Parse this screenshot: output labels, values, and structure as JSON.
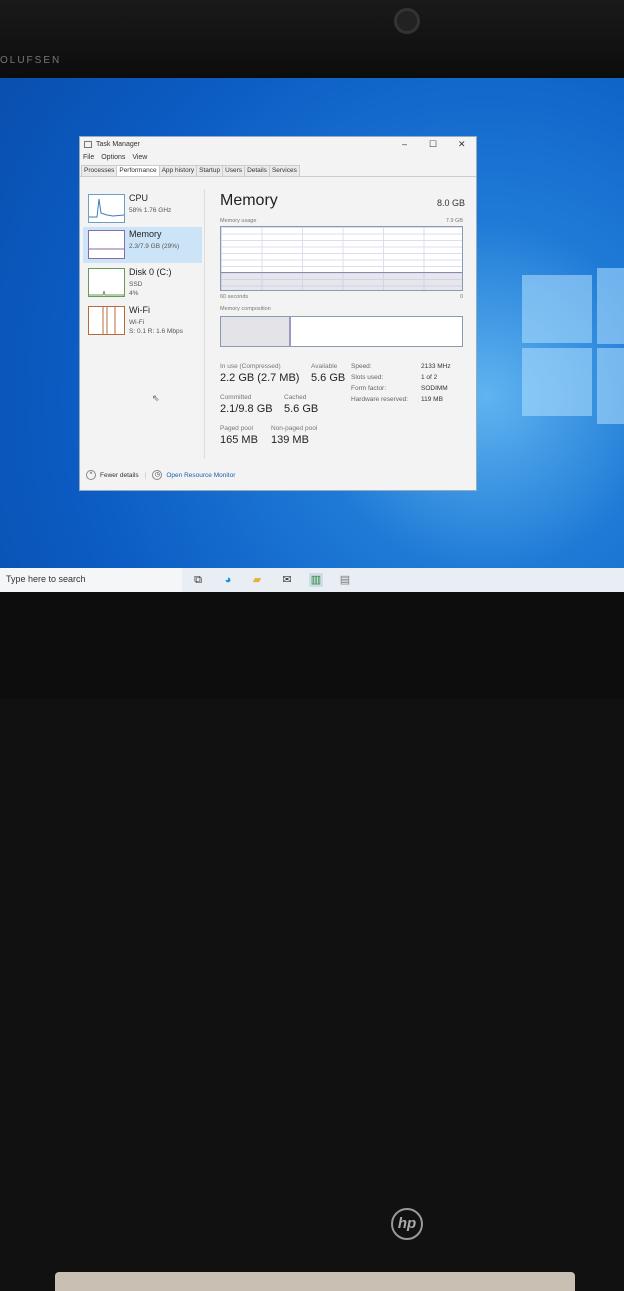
{
  "bezel": {
    "brand": "OLUFSEN",
    "logo": "hp"
  },
  "window": {
    "title": "Task Manager",
    "menu": [
      "File",
      "Options",
      "View"
    ],
    "tabs": [
      "Processes",
      "Performance",
      "App history",
      "Startup",
      "Users",
      "Details",
      "Services"
    ],
    "active_tab": "Performance",
    "devices": [
      {
        "name": "CPU",
        "line1": "58%  1.76 GHz",
        "line2": ""
      },
      {
        "name": "Memory",
        "line1": "2.3/7.9 GB (29%)",
        "line2": ""
      },
      {
        "name": "Disk 0 (C:)",
        "line1": "SSD",
        "line2": "4%"
      },
      {
        "name": "Wi-Fi",
        "line1": "Wi-Fi",
        "line2": "S: 0.1  R: 1.6 Mbps"
      }
    ],
    "main": {
      "title": "Memory",
      "total": "8.0 GB",
      "usage_label": "Memory usage",
      "usage_max": "7.9 GB",
      "time_label": "60 seconds",
      "time_min": "0",
      "usage_percent": 29,
      "composition_label": "Memory composition",
      "composition_in_use_fraction": 0.29,
      "stats": [
        {
          "label": "In use (Compressed)",
          "value": "2.2 GB (2.7 MB)"
        },
        {
          "label": "Available",
          "value": "5.6 GB"
        },
        {
          "label": "Committed",
          "value": "2.1/9.8 GB"
        },
        {
          "label": "Cached",
          "value": "5.6 GB"
        },
        {
          "label": "Paged pool",
          "value": "165 MB"
        },
        {
          "label": "Non-paged pool",
          "value": "139 MB"
        }
      ],
      "props": [
        {
          "key": "Speed:",
          "value": "2133 MHz"
        },
        {
          "key": "Slots used:",
          "value": "1 of 2"
        },
        {
          "key": "Form factor:",
          "value": "SODIMM"
        },
        {
          "key": "Hardware reserved:",
          "value": "119 MB"
        }
      ]
    },
    "footer": {
      "fewer": "Fewer details",
      "monitor": "Open Resource Monitor"
    }
  },
  "taskbar": {
    "search_placeholder": "Type here to search"
  }
}
